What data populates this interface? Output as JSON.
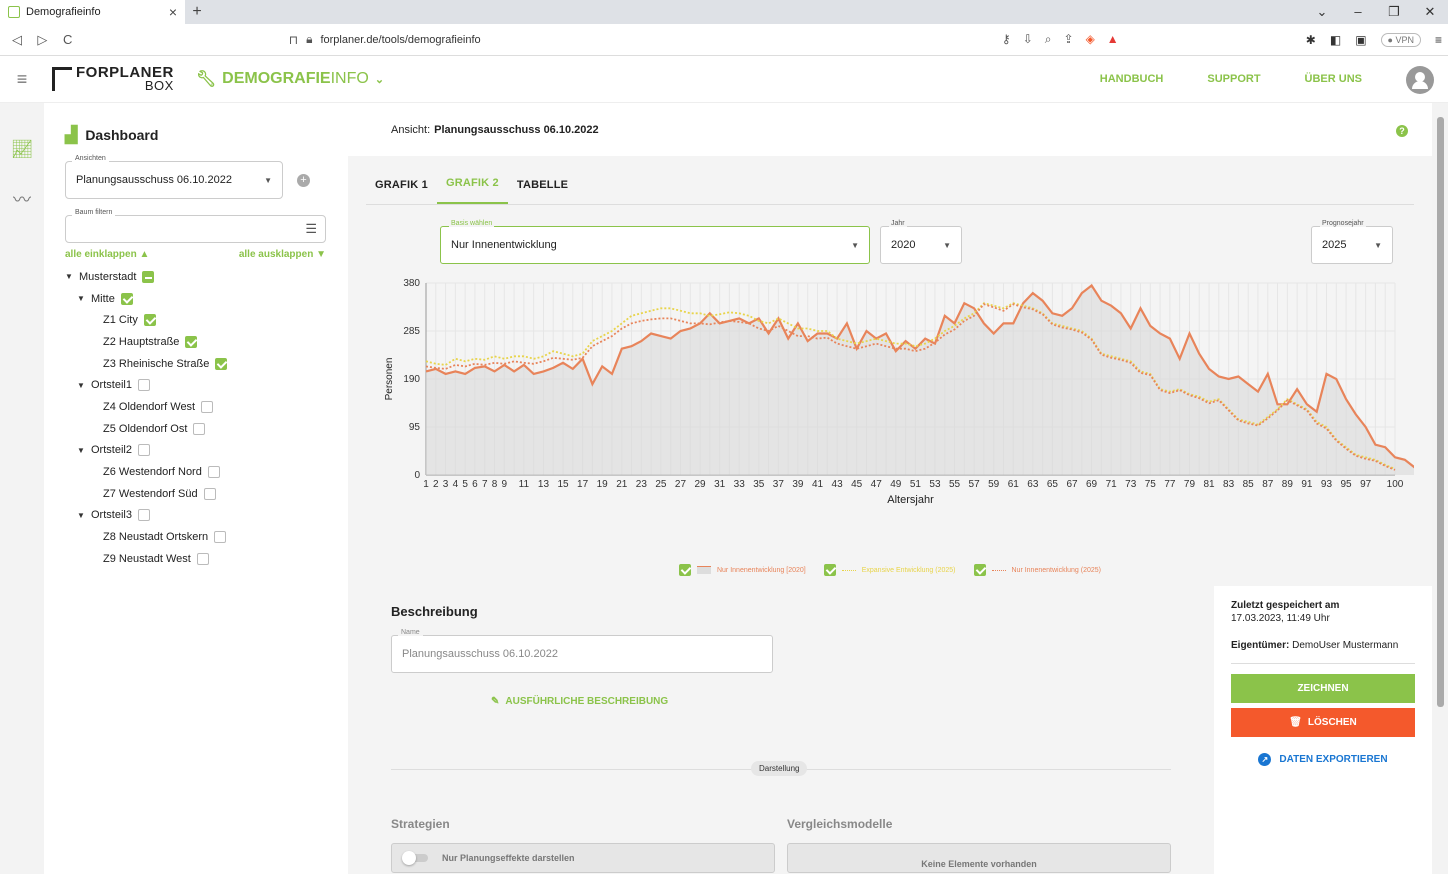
{
  "browser": {
    "tab_title": "Demografieinfo",
    "url": "forplaner.de/tools/demografieinfo",
    "vpn": "● VPN"
  },
  "header": {
    "logo_top": "FORPLANER",
    "logo_bottom": "BOX",
    "app_bold": "DEMOGRAFIE",
    "app_thin": "INFO",
    "nav": [
      "HANDBUCH",
      "SUPPORT",
      "ÜBER UNS"
    ]
  },
  "sidebar": {
    "title": "Dashboard",
    "views_label": "Ansichten",
    "views_value": "Planungsausschuss 06.10.2022",
    "filter_label": "Baum filtern",
    "collapse_all": "alle einklappen ▲",
    "expand_all": "alle ausklappen ▼",
    "tree": [
      {
        "label": "Musterstadt",
        "level": 0,
        "caret": true,
        "state": "part"
      },
      {
        "label": "Mitte",
        "level": 1,
        "caret": true,
        "state": "on"
      },
      {
        "label": "Z1 City",
        "level": 2,
        "caret": false,
        "state": "on"
      },
      {
        "label": "Z2 Hauptstraße",
        "level": 2,
        "caret": false,
        "state": "on"
      },
      {
        "label": "Z3 Rheinische Straße",
        "level": 2,
        "caret": false,
        "state": "on"
      },
      {
        "label": "Ortsteil1",
        "level": 1,
        "caret": true,
        "state": "off"
      },
      {
        "label": "Z4 Oldendorf West",
        "level": 2,
        "caret": false,
        "state": "off"
      },
      {
        "label": "Z5 Oldendorf Ost",
        "level": 2,
        "caret": false,
        "state": "off"
      },
      {
        "label": "Ortsteil2",
        "level": 1,
        "caret": true,
        "state": "off"
      },
      {
        "label": "Z6 Westendorf Nord",
        "level": 2,
        "caret": false,
        "state": "off"
      },
      {
        "label": "Z7 Westendorf Süd",
        "level": 2,
        "caret": false,
        "state": "off"
      },
      {
        "label": "Ortsteil3",
        "level": 1,
        "caret": true,
        "state": "off"
      },
      {
        "label": "Z8 Neustadt Ortskern",
        "level": 2,
        "caret": false,
        "state": "off"
      },
      {
        "label": "Z9 Neustadt West",
        "level": 2,
        "caret": false,
        "state": "off"
      }
    ]
  },
  "main": {
    "view_prefix": "Ansicht:",
    "view_name": "Planungsausschuss 06.10.2022",
    "tabs": [
      "GRAFIK 1",
      "GRAFIK 2",
      "TABELLE"
    ],
    "active_tab": 1,
    "basis_label": "Basis wählen",
    "basis_value": "Nur Innenentwicklung",
    "jahr_label": "Jahr",
    "jahr_value": "2020",
    "prognose_label": "Prognosejahr",
    "prognose_value": "2025"
  },
  "chart_data": {
    "type": "line",
    "xlabel": "Altersjahr",
    "ylabel": "Personen",
    "ylim": [
      0,
      380
    ],
    "yticks": [
      0,
      95,
      190,
      285,
      380
    ],
    "xlim": [
      1,
      100
    ],
    "xticks": [
      1,
      2,
      3,
      4,
      5,
      6,
      7,
      8,
      9,
      11,
      13,
      15,
      17,
      19,
      21,
      23,
      25,
      27,
      29,
      31,
      33,
      35,
      37,
      39,
      41,
      43,
      45,
      47,
      49,
      51,
      53,
      55,
      57,
      59,
      61,
      63,
      65,
      67,
      69,
      71,
      73,
      75,
      77,
      79,
      81,
      83,
      85,
      87,
      89,
      91,
      93,
      95,
      97,
      100
    ],
    "series": [
      {
        "name": "Nur Innenentwicklung [2020]",
        "color": "#e8845a",
        "style": "area-solid",
        "values": [
          205,
          210,
          200,
          205,
          200,
          212,
          215,
          205,
          218,
          205,
          218,
          200,
          205,
          212,
          222,
          210,
          230,
          180,
          215,
          200,
          250,
          255,
          265,
          280,
          275,
          270,
          285,
          290,
          300,
          320,
          300,
          305,
          310,
          300,
          310,
          280,
          310,
          270,
          300,
          265,
          280,
          280,
          270,
          300,
          250,
          285,
          270,
          280,
          245,
          265,
          250,
          270,
          260,
          315,
          300,
          340,
          330,
          300,
          280,
          300,
          300,
          340,
          360,
          345,
          320,
          315,
          330,
          360,
          375,
          345,
          335,
          320,
          290,
          330,
          295,
          280,
          270,
          230,
          280,
          240,
          210,
          195,
          190,
          195,
          180,
          165,
          200,
          140,
          140,
          170,
          140,
          125,
          200,
          190,
          150,
          120,
          95,
          60,
          55,
          35,
          30,
          15,
          10,
          12
        ]
      },
      {
        "name": "Expansive Entwicklung (2025)",
        "color": "#e8d44a",
        "style": "dotted",
        "values": [
          225,
          220,
          218,
          230,
          225,
          230,
          228,
          235,
          230,
          235,
          235,
          230,
          235,
          245,
          240,
          235,
          240,
          265,
          275,
          285,
          300,
          315,
          320,
          325,
          330,
          330,
          325,
          320,
          320,
          315,
          318,
          322,
          320,
          315,
          305,
          300,
          310,
          300,
          290,
          290,
          285,
          285,
          270,
          265,
          260,
          265,
          270,
          265,
          260,
          260,
          255,
          260,
          270,
          285,
          295,
          310,
          320,
          340,
          335,
          330,
          340,
          335,
          330,
          320,
          300,
          295,
          290,
          285,
          270,
          240,
          235,
          230,
          225,
          205,
          200,
          170,
          165,
          170,
          160,
          155,
          145,
          150,
          130,
          110,
          105,
          100,
          115,
          130,
          150,
          140,
          130,
          105,
          95,
          70,
          55,
          40,
          35,
          30,
          20,
          12
        ]
      },
      {
        "name": "Nur Innenentwicklung (2025)",
        "color": "#e8845a",
        "style": "dotted",
        "values": [
          215,
          212,
          210,
          218,
          215,
          220,
          218,
          222,
          220,
          225,
          222,
          220,
          225,
          232,
          230,
          228,
          232,
          255,
          265,
          275,
          290,
          300,
          305,
          308,
          310,
          310,
          305,
          300,
          300,
          298,
          302,
          305,
          303,
          300,
          290,
          285,
          295,
          285,
          275,
          275,
          270,
          272,
          260,
          255,
          250,
          255,
          260,
          255,
          250,
          250,
          245,
          250,
          262,
          278,
          288,
          305,
          315,
          338,
          332,
          325,
          338,
          332,
          328,
          318,
          298,
          292,
          288,
          282,
          268,
          238,
          232,
          228,
          222,
          202,
          198,
          168,
          162,
          168,
          158,
          152,
          142,
          148,
          128,
          108,
          102,
          98,
          112,
          128,
          148,
          138,
          128,
          102,
          92,
          68,
          52,
          38,
          32,
          28,
          18,
          10
        ]
      }
    ],
    "legend_position": "bottom-center",
    "grid": true
  },
  "description": {
    "title": "Beschreibung",
    "name_label": "Name",
    "name_value": "Planungsausschuss 06.10.2022",
    "long_desc": "AUSFÜHRLICHE BESCHREIBUNG",
    "separator": "Darstellung",
    "strategies_title": "Strategien",
    "strategies_toggle": "Nur Planungseffekte darstellen",
    "compare_title": "Vergleichsmodelle",
    "compare_empty": "Keine Elemente vorhanden"
  },
  "meta": {
    "saved_label": "Zuletzt gespeichert am",
    "saved_value": "17.03.2023, 11:49 Uhr",
    "owner_label": "Eigentümer:",
    "owner_value": "DemoUser Mustermann",
    "draw_button": "ZEICHNEN",
    "delete_button": "LÖSCHEN",
    "export_link": "DATEN EXPORTIEREN"
  }
}
